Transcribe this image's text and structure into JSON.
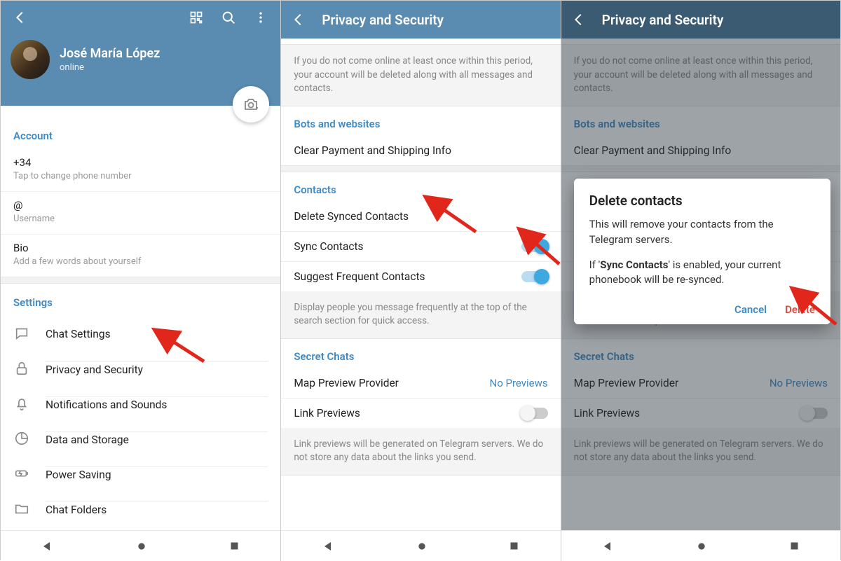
{
  "s1": {
    "name": "José María López",
    "status": "online",
    "account_hdr": "Account",
    "phone_prefix": "+34",
    "phone_hint": "Tap to change phone number",
    "username_at": "@",
    "username_hint": "Username",
    "bio_label": "Bio",
    "bio_hint": "Add a few words about yourself",
    "settings_hdr": "Settings",
    "settings": {
      "chat": "Chat Settings",
      "privacy": "Privacy and Security",
      "notif": "Notifications and Sounds",
      "data": "Data and Storage",
      "power": "Power Saving",
      "folders": "Chat Folders"
    }
  },
  "s2": {
    "title": "Privacy and Security",
    "deletion_note": "If you do not come online at least once within this period, your account will be deleted along with all messages and contacts.",
    "bots_hdr": "Bots and websites",
    "clear_payment": "Clear Payment and Shipping Info",
    "contacts_hdr": "Contacts",
    "delete_synced": "Delete Synced Contacts",
    "sync_contacts": "Sync Contacts",
    "suggest": "Suggest Frequent Contacts",
    "suggest_note": "Display people you message frequently at the top of the search section for quick access.",
    "secret_hdr": "Secret Chats",
    "map_provider": "Map Preview Provider",
    "map_value": "No Previews",
    "link_previews": "Link Previews",
    "link_note": "Link previews will be generated on Telegram servers. We do not store any data about the links you send."
  },
  "s3": {
    "title": "Privacy and Security",
    "dialog_title": "Delete contacts",
    "dialog_p1": "This will remove your contacts from the Telegram servers.",
    "dialog_p2a": "If '",
    "dialog_p2b": "Sync Contacts",
    "dialog_p2c": "' is enabled, your current phonebook will be re-synced.",
    "cancel": "Cancel",
    "delete": "Delete"
  }
}
